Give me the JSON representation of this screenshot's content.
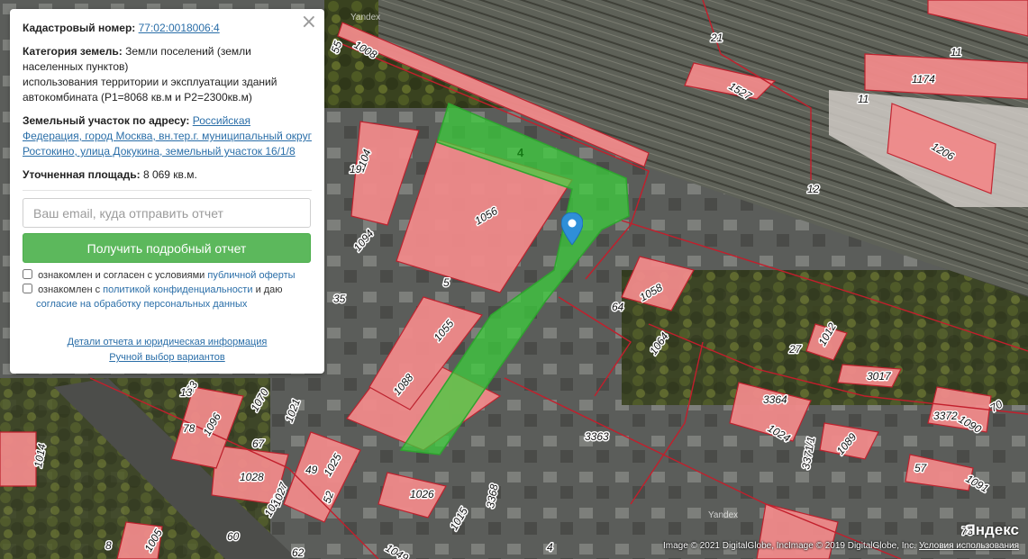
{
  "panel": {
    "cadastral_label": "Кадастровый номер:",
    "cadastral_value": "77:02:0018006:4",
    "category_label": "Категория земель:",
    "category_value": "Земли поселений (земли населенных пунктов)",
    "usage_text": "использования территории и эксплуатации зданий автокомбината (P1=8068 кв.м и P2=2300кв.м)",
    "address_label": "Земельный участок по адресу:",
    "address_value": "Российская Федерация, город Москва, вн.тер.г. муниципальный округ Ростокино, улица Докукина, земельный участок 16/1/8",
    "area_label": "Уточненная площадь:",
    "area_value": "8 069 кв.м.",
    "email_placeholder": "Ваш email, куда отправить отчет",
    "submit_label": "Получить подробный отчет",
    "consent1_text": "ознакомлен и согласен с условиями",
    "consent1_link": "публичной оферты",
    "consent2_text": "ознакомлен с",
    "consent2_link": "политикой конфиденциальности",
    "consent2_text2": "и даю",
    "consent2_link2": "согласие на обработку персональных данных",
    "details_link": "Детали отчета и юридическая информация",
    "manual_link": "Ручной выбор вариантов",
    "close_symbol": "×"
  },
  "map": {
    "parcel_number": "4",
    "watermark": "Yandex",
    "watermark2": "Yandex",
    "labels": [
      "1056",
      "1088",
      "1055",
      "1104",
      "19",
      "1094",
      "5",
      "35",
      "1058",
      "64",
      "1064",
      "27",
      "1012",
      "3017",
      "3364",
      "1024",
      "3372",
      "1090",
      "70",
      "1089",
      "3371/1",
      "57",
      "1091",
      "73",
      "3363",
      "1026",
      "1015",
      "3368",
      "1049",
      "1008",
      "55",
      "21",
      "11",
      "1527",
      "11",
      "1174",
      "1206",
      "12",
      "1096",
      "78",
      "1021",
      "67",
      "1028",
      "49",
      "1025",
      "1014",
      "53",
      "1029",
      "52",
      "60",
      "8",
      "1005",
      "62",
      "1070",
      "4",
      "1027",
      "13"
    ],
    "copyright_left": "Image © 2021 DigitalGlobe, Inc.",
    "copyright_right": "Image © 2019 DigitalGlobe, Inc.",
    "logo": "Яндекс",
    "terms": "Условия использования"
  },
  "colors": {
    "parcel_fill": "#3bd13b",
    "building_fill": "#f08a8a",
    "boundary": "#c21f2c",
    "marker": "#2f8fd8",
    "button": "#5cb85c"
  }
}
